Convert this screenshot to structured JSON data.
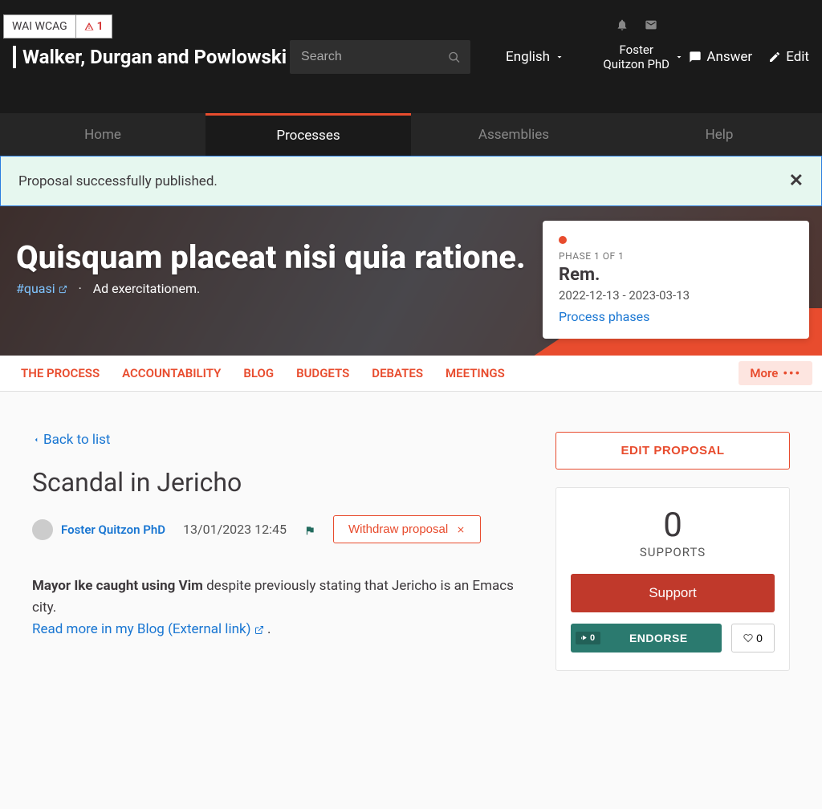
{
  "wcag": {
    "label": "WAI WCAG",
    "count": "1"
  },
  "brand": "Walker, Durgan and Powlowski",
  "search": {
    "placeholder": "Search"
  },
  "lang": "English",
  "user": {
    "name": "Foster Quitzon PhD"
  },
  "header_actions": {
    "answer": "Answer",
    "edit": "Edit"
  },
  "mainnav": {
    "home": "Home",
    "processes": "Processes",
    "assemblies": "Assemblies",
    "help": "Help"
  },
  "success": {
    "message": "Proposal successfully published."
  },
  "hero": {
    "title": "Quisquam placeat nisi quia ratione.",
    "hashtag": "#quasi",
    "subtitle": "Ad exercitationem."
  },
  "phase": {
    "label": "PHASE 1 OF 1",
    "name": "Rem.",
    "dates": "2022-12-13 - 2023-03-13",
    "link": "Process phases"
  },
  "secnav": {
    "process": "THE PROCESS",
    "accountability": "ACCOUNTABILITY",
    "blog": "BLOG",
    "budgets": "BUDGETS",
    "debates": "DEBATES",
    "meetings": "MEETINGS",
    "more": "More"
  },
  "proposal": {
    "back": "Back to list",
    "title": "Scandal in Jericho",
    "author": "Foster Quitzon PhD",
    "date": "13/01/2023 12:45",
    "withdraw": "Withdraw proposal",
    "body_strong": "Mayor Ike caught using Vim",
    "body_rest": " despite previously stating that Jericho is an Emacs city.",
    "readmore": "Read more in my Blog (External link)",
    "period": " ."
  },
  "side": {
    "edit": "EDIT PROPOSAL",
    "support_count": "0",
    "support_label": "SUPPORTS",
    "support_btn": "Support",
    "endorse_count": "0",
    "endorse": "ENDORSE",
    "like_count": "0"
  }
}
